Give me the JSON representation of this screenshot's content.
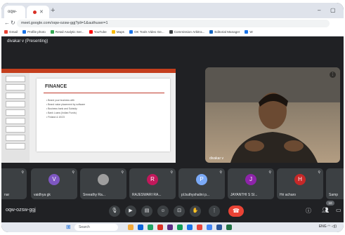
{
  "browser": {
    "tabs": [
      {
        "label": "oqw-"
      },
      {
        "label": "Meet"
      }
    ],
    "url": "meet.google.com/oqw-ozsw-ggj?pli=1&authuser=1",
    "bookmarks": [
      {
        "label": "Gmail",
        "color": "#ea4335"
      },
      {
        "label": "Profile photo",
        "color": "#1a73e8"
      },
      {
        "label": "Retail Analytic Ser...",
        "color": "#34a853"
      },
      {
        "label": "YouTube",
        "color": "#ff0000"
      },
      {
        "label": "Maps",
        "color": "#fbbc04"
      },
      {
        "label": "OK Tools Video Ge...",
        "color": "#1a73e8"
      },
      {
        "label": "Commission Arbitra...",
        "color": "#3c4043"
      },
      {
        "label": "Editorial Manager",
        "color": "#1565c0"
      },
      {
        "label": "W",
        "color": "#1a73e8"
      }
    ]
  },
  "meet": {
    "presenting_label": "divakar v (Presenting)",
    "slide": {
      "title": "FINANCE",
      "bullets": [
        "Brand your business with",
        "Brand value placement by software",
        "Business bank and Subsidy",
        "Bank Loans (Indian Funds)",
        "Finland & 10/23"
      ]
    },
    "speaker_name": "divakar v",
    "participants": [
      {
        "initial": "",
        "name": "nar",
        "color": "#5f6368"
      },
      {
        "initial": "V",
        "name": "vaidhya gk",
        "color": "#7e57c2"
      },
      {
        "initial": "",
        "name": "Sreeathy Ra...",
        "color": "#9e9e9e"
      },
      {
        "initial": "R",
        "name": "RAJESWARI RA...",
        "color": "#c2185b"
      },
      {
        "initial": "P",
        "name": "pl.buthyshalini p...",
        "color": "#7baaf7"
      },
      {
        "initial": "J",
        "name": "JAYANTHI S SI...",
        "color": "#8e24aa"
      },
      {
        "initial": "H",
        "name": "Hri acharo",
        "color": "#c62828"
      },
      {
        "initial": "",
        "name": "Samp",
        "color": "#5f6368"
      }
    ],
    "meeting_code": "oqw-ozsw-ggj",
    "people_count": "10"
  },
  "taskbar": {
    "search_placeholder": "Search",
    "tray_text": "ENG"
  }
}
